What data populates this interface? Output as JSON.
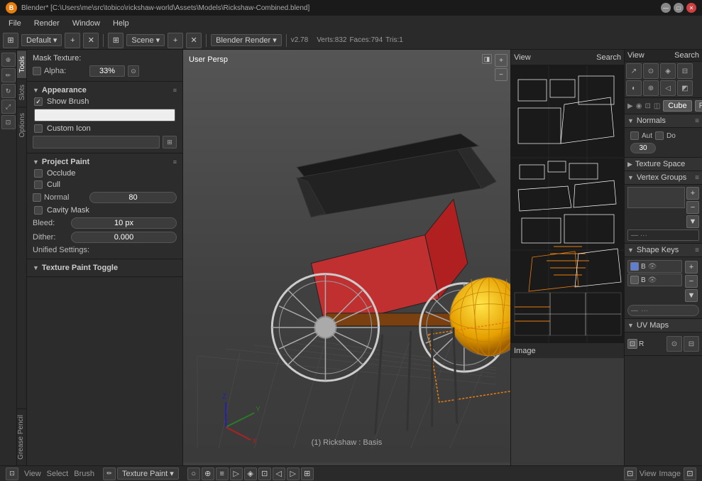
{
  "titlebar": {
    "title": "Blender* [C:\\Users\\me\\src\\tobico\\rickshaw-world\\Assets\\Models\\Rickshaw-Combined.blend]",
    "logo": "B",
    "minimize": "—",
    "maximize": "□",
    "close": "✕"
  },
  "menubar": {
    "items": [
      "File",
      "Render",
      "Window",
      "Help"
    ]
  },
  "header": {
    "workspace": "Default",
    "engine": "Blender Render",
    "version": "v2.78",
    "verts": "Verts:832",
    "faces": "Faces:794",
    "tris": "Tris:1",
    "scene": "Scene"
  },
  "left_panel": {
    "mask_texture_label": "Mask Texture:",
    "alpha_label": "Alpha:",
    "alpha_value": "33%",
    "appearance_label": "Appearance",
    "show_brush_label": "Show Brush",
    "custom_icon_label": "Custom Icon",
    "project_paint_label": "Project Paint",
    "occlude_label": "Occlude",
    "cull_label": "Cull",
    "normal_label": "Normal",
    "normal_value": "80",
    "cavity_mask_label": "Cavity Mask",
    "bleed_label": "Bleed:",
    "bleed_value": "10 px",
    "dither_label": "Dither:",
    "dither_value": "0.000",
    "unified_label": "Unified Settings:",
    "texture_paint_toggle": "Texture Paint Toggle"
  },
  "viewport": {
    "label": "User Persp"
  },
  "side_tabs": [
    "Tools",
    "Slots",
    "Options"
  ],
  "grease_tab": "Grease Pencil",
  "right_panel": {
    "view_label": "View",
    "search_label": "Search",
    "cube_label": "Cube",
    "f_label": "F",
    "normals_label": "Normals",
    "aut_label": "Aut",
    "do_label": "Do",
    "value_30": "30",
    "texture_space_label": "Texture Space",
    "vertex_groups_label": "Vertex Groups",
    "shape_keys_label": "Shape Keys",
    "shape_key_b1": "B",
    "shape_key_b2": "B",
    "uv_maps_label": "UV Maps",
    "r_label": "R"
  },
  "status_bar": {
    "view": "View",
    "select": "Select",
    "brush": "Brush",
    "mode": "Texture Paint",
    "basis_text": "(1) Rickshaw : Basis"
  },
  "uv_panel": {
    "header": "View",
    "search": "Search",
    "image": "Image"
  }
}
